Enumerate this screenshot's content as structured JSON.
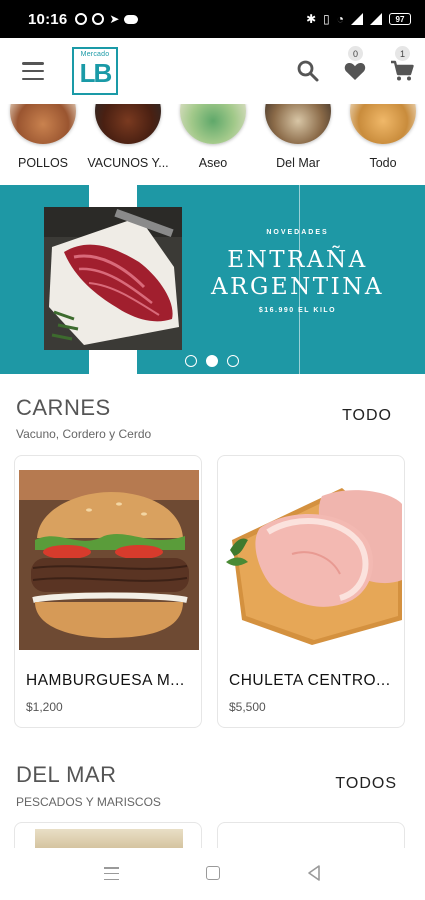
{
  "status_bar": {
    "time": "10:16",
    "battery": "97"
  },
  "header": {
    "logo": {
      "top": "Mercado",
      "main": "LB"
    },
    "favorites_count": "0",
    "cart_count": "1"
  },
  "categories": [
    {
      "label": "POLLOS"
    },
    {
      "label": "VACUNOS Y..."
    },
    {
      "label": "Aseo"
    },
    {
      "label": "Del Mar"
    },
    {
      "label": "Todo"
    }
  ],
  "banner": {
    "kicker": "NOVEDADES",
    "title": "ENTRAÑA ARGENTINA",
    "price": "$16.990 EL KILO",
    "active_slide": 2,
    "slide_count": 3
  },
  "sections": [
    {
      "title": "CARNES",
      "subtitle": "Vacuno, Cordero y Cerdo",
      "see_all": "TODO",
      "products": [
        {
          "name": "HAMBURGUESA M...",
          "price": "$1,200"
        },
        {
          "name": "CHULETA CENTRO...",
          "price": "$5,500"
        }
      ]
    },
    {
      "title": "DEL MAR",
      "subtitle": "PESCADOS Y MARISCOS",
      "see_all": "TODOS"
    }
  ],
  "colors": {
    "brand": "#1e98a5",
    "status_bar": "#000000"
  },
  "icons": [
    "menu-icon",
    "search-icon",
    "heart-icon",
    "cart-icon",
    "nav-recents-icon",
    "nav-home-icon",
    "nav-back-icon"
  ]
}
